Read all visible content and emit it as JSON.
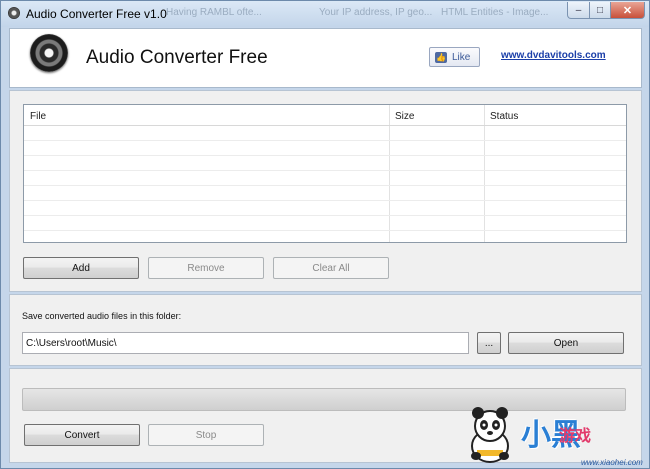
{
  "window": {
    "title": "Audio Converter Free v1.0",
    "ghost_tabs": [
      "Having RAMBL ofte...",
      "Your IP address, IP geo...",
      "HTML Entities - Image..."
    ],
    "controls": {
      "minimize": "–",
      "maximize": "□",
      "close": "✕"
    }
  },
  "header": {
    "app_name": "Audio Converter Free",
    "like_label": "Like",
    "site_link": "www.dvdavitools.com"
  },
  "file_list": {
    "columns": [
      "File",
      "Size",
      "Status"
    ],
    "rows": []
  },
  "list_buttons": {
    "add": "Add",
    "remove": "Remove",
    "clear_all": "Clear All"
  },
  "output": {
    "label": "Save converted audio files in this folder:",
    "folder_path": "C:\\Users\\root\\Music\\",
    "browse_label": "...",
    "open_label": "Open"
  },
  "progress": {
    "fraction": 0.0
  },
  "actions": {
    "convert": "Convert",
    "stop": "Stop"
  },
  "watermark": {
    "brand": "小黑",
    "suffix": "游戏",
    "url": "www.xiaohei.com"
  },
  "colors": {
    "frame": "#c5d6ea",
    "link": "#1a3ea8",
    "facebook": "#3b5998"
  }
}
